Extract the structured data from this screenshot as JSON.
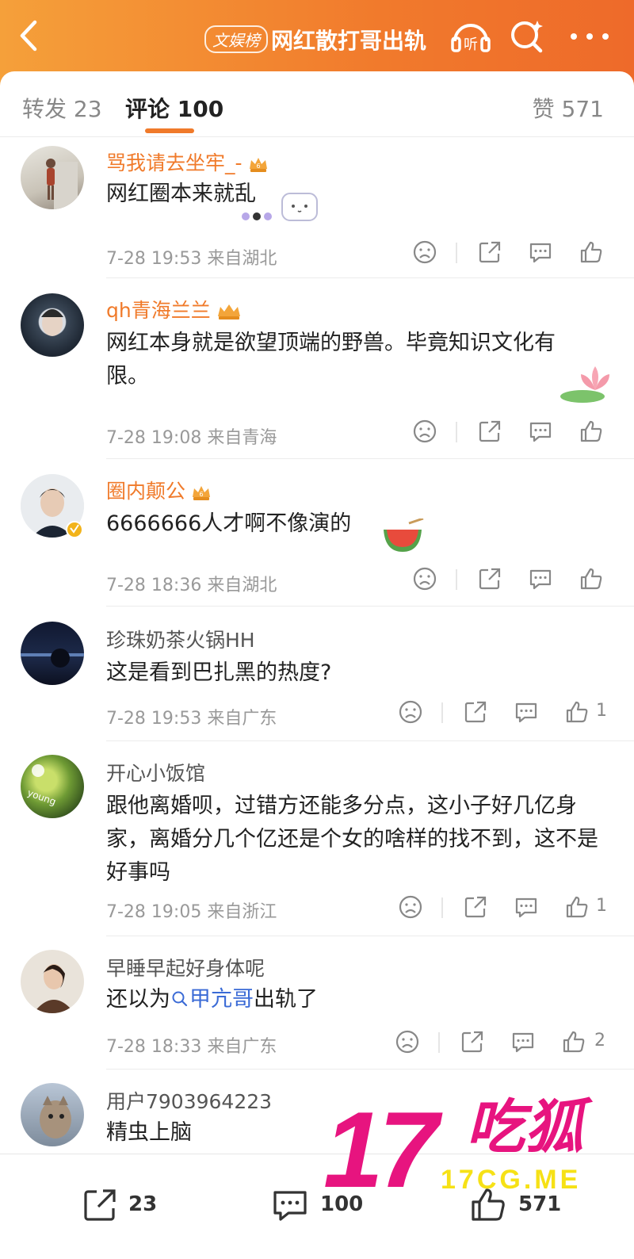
{
  "header": {
    "tag": "文娱榜",
    "title": "网红散打哥出轨",
    "listen_label": "听"
  },
  "tabs": {
    "repost": "转发 23",
    "comments": "评论 100",
    "likes": "赞 571"
  },
  "comments": [
    {
      "user": "骂我请去坐牢_-",
      "vip": true,
      "text": "网红圈本来就乱",
      "time": "7-28 19:53",
      "location": "来自湖北",
      "like_count": ""
    },
    {
      "user": "qh青海兰兰",
      "vip": true,
      "text": "网红本身就是欲望顶端的野兽。毕竟知识文化有限。",
      "time": "7-28 19:08",
      "location": "来自青海",
      "like_count": ""
    },
    {
      "user": "圈内颠公",
      "vip": true,
      "text": "6666666人才啊不像演的",
      "time": "7-28 18:36",
      "location": "来自湖北",
      "like_count": ""
    },
    {
      "user": "珍珠奶茶火锅HH",
      "vip": false,
      "text": "这是看到巴扎黑的热度?",
      "time": "7-28 19:53",
      "location": "来自广东",
      "like_count": "1"
    },
    {
      "user": "开心小饭馆",
      "vip": false,
      "text": "跟他离婚呗，过错方还能多分点，这小子好几亿身家，离婚分几个亿还是个女的啥样的找不到，这不是好事吗",
      "time": "7-28 19:05",
      "location": "来自浙江",
      "like_count": "1"
    },
    {
      "user": "早睡早起好身体呢",
      "vip": false,
      "text_prefix": "还以为",
      "text_link": "甲亢哥",
      "text_suffix": "出轨了",
      "time": "7-28 18:33",
      "location": "来自广东",
      "like_count": "2"
    },
    {
      "user": "用户7903964223",
      "vip": false,
      "text": "精虫上脑"
    }
  ],
  "bottom": {
    "repost_count": "23",
    "comment_count": "100",
    "like_count": "571"
  },
  "watermark": {
    "number": "17",
    "chinese": "吃狐",
    "url": "17CG.ME"
  },
  "colors": {
    "header_start": "#f5a03a",
    "header_end": "#ee6a2a",
    "vip_name": "#f07a2a",
    "link": "#3b6bd6",
    "watermark_pink": "#e7147f",
    "watermark_yellow": "#f6e116"
  }
}
